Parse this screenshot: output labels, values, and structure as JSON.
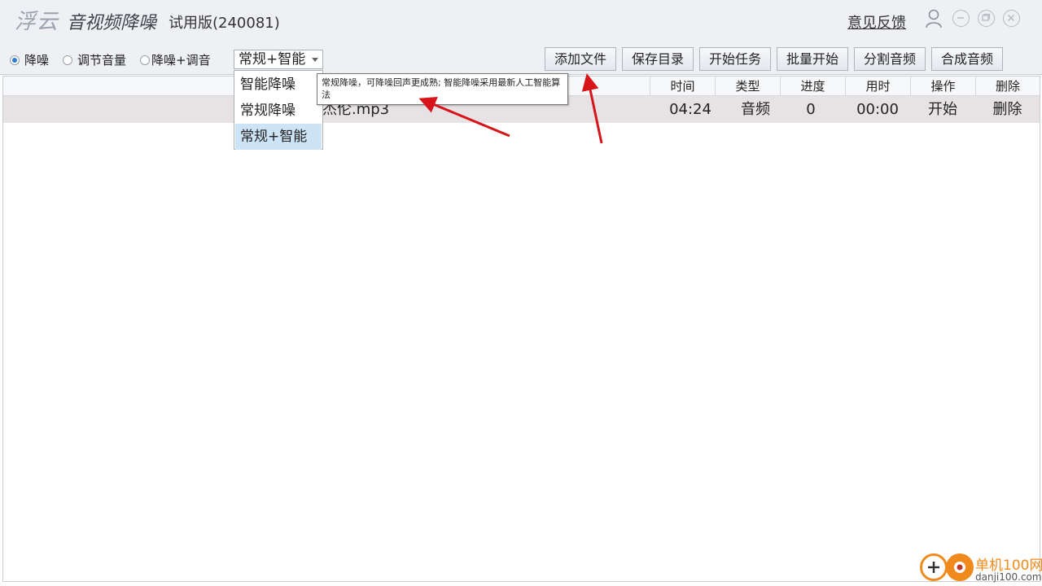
{
  "titlebar": {
    "logo": "浮云",
    "app_name": "音视频降噪",
    "version": "试用版(240081)",
    "feedback": "意见反馈",
    "icons": [
      "user-icon",
      "minimize-icon",
      "restore-icon",
      "close-icon"
    ]
  },
  "modes": [
    {
      "label": "降噪",
      "checked": true
    },
    {
      "label": "调节音量",
      "checked": false
    },
    {
      "label": "降噪+调音",
      "checked": false
    }
  ],
  "algorithm_select": {
    "value": "常规+智能",
    "options": [
      "智能降噪",
      "常规降噪",
      "常规+智能"
    ],
    "selected_index": 2
  },
  "tooltip": "常规降噪，可降噪回声更成熟; 智能降噪采用最新人工智能算法",
  "toolbar": {
    "buttons": [
      "添加文件",
      "保存目录",
      "开始任务",
      "批量开始",
      "分割音频",
      "合成音频"
    ]
  },
  "table": {
    "columns": [
      "时间",
      "类型",
      "进度",
      "用时",
      "操作",
      "删除"
    ],
    "rows": [
      {
        "name": "杰伦.mp3",
        "time": "04:24",
        "type": "音频",
        "progress": "0",
        "elapsed": "00:00",
        "action": "开始",
        "delete": "删除"
      }
    ]
  },
  "watermark": {
    "brand": "单机100网",
    "url": "danji100.com"
  },
  "colors": {
    "accent": "#2c7fd6",
    "selected_bg": "#cde3f6",
    "row_bg": "#e7e3e5",
    "arrow": "#d7141a"
  }
}
